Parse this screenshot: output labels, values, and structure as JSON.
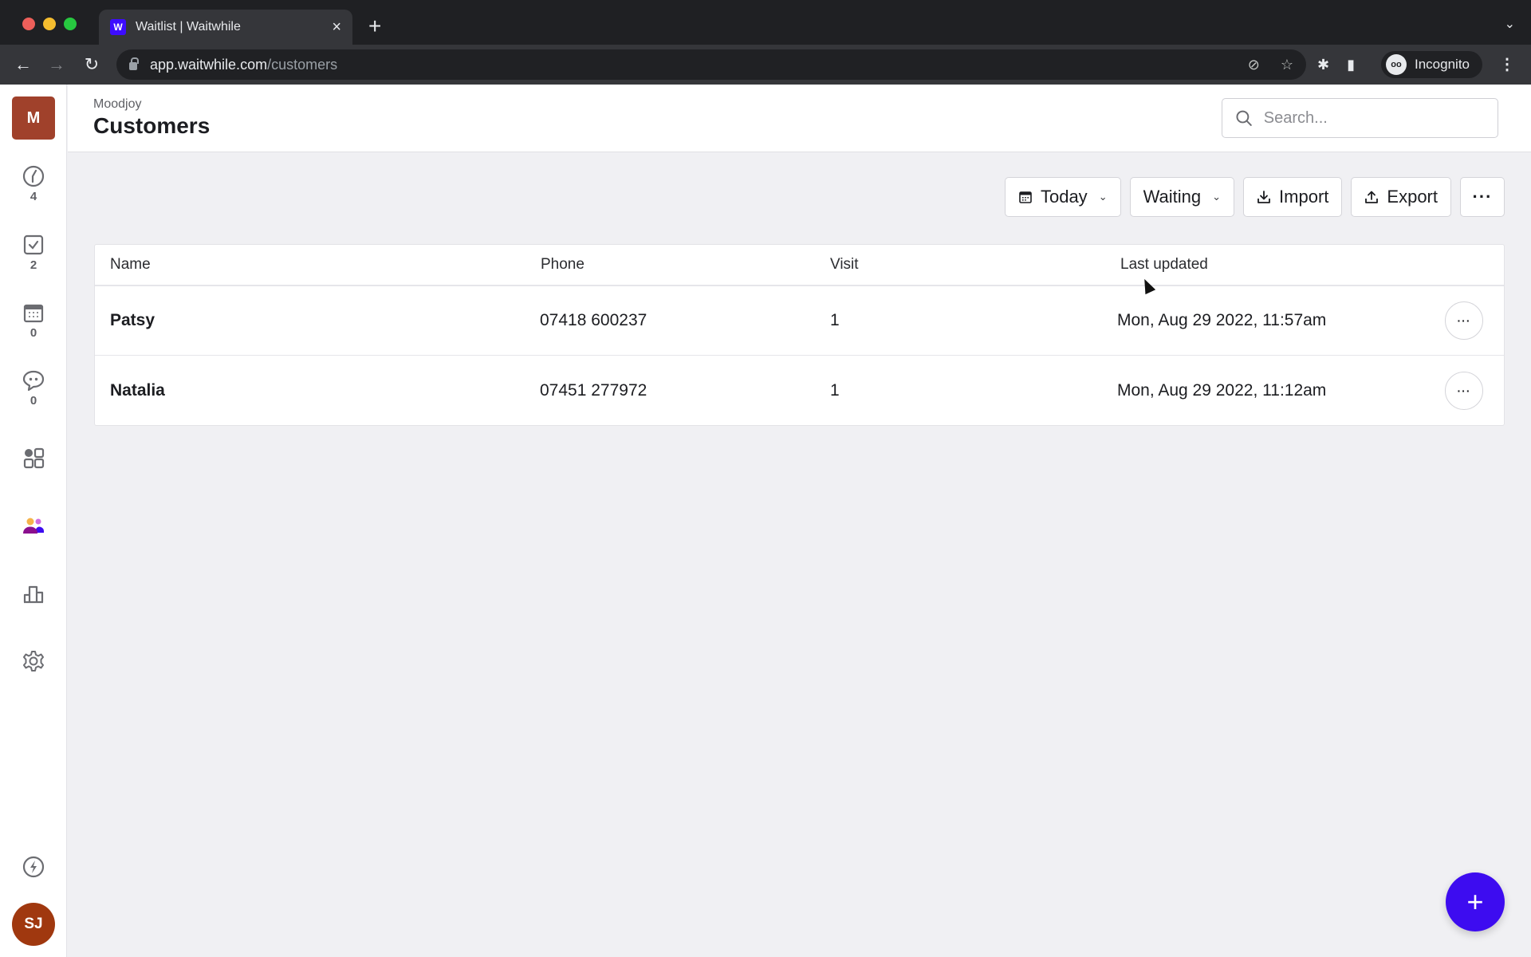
{
  "browser": {
    "tab_title": "Waitlist | Waitwhile",
    "favicon": "W",
    "url_host": "app.waitwhile.com",
    "url_path": "/customers",
    "profile_label": "Incognito"
  },
  "sidebar": {
    "org_initial": "M",
    "items": [
      {
        "icon": "dashboard-gauge-icon",
        "count": "4"
      },
      {
        "icon": "checklist-icon",
        "count": "2"
      },
      {
        "icon": "calendar-icon",
        "count": "0"
      },
      {
        "icon": "chat-icon",
        "count": "0"
      },
      {
        "icon": "apps-grid-icon",
        "count": ""
      },
      {
        "icon": "customers-icon",
        "count": "",
        "active": true
      },
      {
        "icon": "analytics-icon",
        "count": ""
      },
      {
        "icon": "settings-icon",
        "count": ""
      }
    ],
    "user_initials": "SJ"
  },
  "header": {
    "breadcrumb": "Moodjoy",
    "title": "Customers",
    "search_placeholder": "Search..."
  },
  "actions": {
    "date_filter": "Today",
    "status_filter": "Waiting",
    "import_label": "Import",
    "export_label": "Export",
    "more_label": "···"
  },
  "table": {
    "columns": [
      "Name",
      "Phone",
      "Visit",
      "Last updated"
    ],
    "rows": [
      {
        "name": "Patsy",
        "phone": "07418 600237",
        "visit": "1",
        "updated": "Mon, Aug 29 2022, 11:57am"
      },
      {
        "name": "Natalia",
        "phone": "07451 277972",
        "visit": "1",
        "updated": "Mon, Aug 29 2022, 11:12am"
      }
    ],
    "row_menu_label": "···"
  },
  "fab_label": "+",
  "colors": {
    "brand": "#3d0cf0",
    "org_badge": "#a0412b",
    "user_avatar": "#a0380f"
  }
}
